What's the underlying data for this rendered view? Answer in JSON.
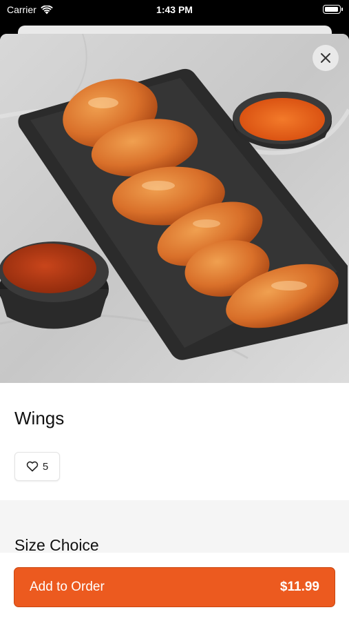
{
  "status_bar": {
    "carrier": "Carrier",
    "time": "1:43 PM"
  },
  "item": {
    "title": "Wings",
    "likes": "5"
  },
  "section": {
    "title": "Size Choice"
  },
  "order_button": {
    "label": "Add to Order",
    "price": "$11.99"
  },
  "colors": {
    "accent": "#ec5a1f",
    "section_bg": "#f5f5f5"
  },
  "icons": {
    "close": "close-icon",
    "heart": "heart-icon",
    "wifi": "wifi-icon",
    "battery": "battery-icon"
  }
}
